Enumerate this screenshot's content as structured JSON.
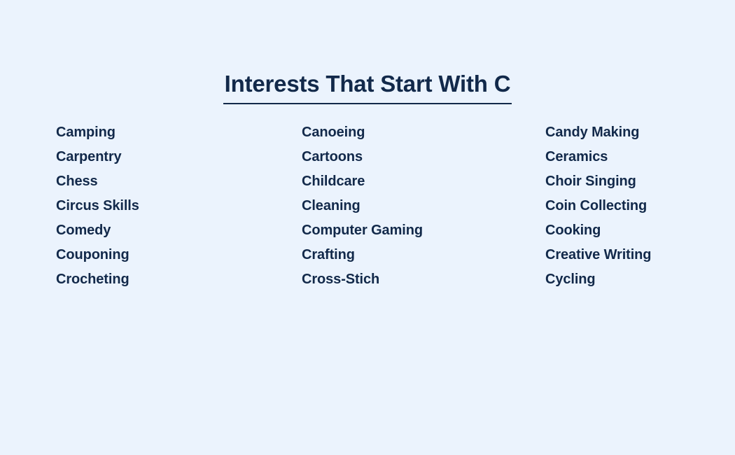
{
  "theme": {
    "background_color": "#ebf3fd",
    "text_color": "#12294a",
    "underline_color": "#12294a"
  },
  "header": {
    "title": "Interests That Start With C"
  },
  "list": {
    "columns": [
      {
        "items": [
          {
            "label": "Camping"
          },
          {
            "label": "Carpentry"
          },
          {
            "label": "Chess"
          },
          {
            "label": "Circus Skills"
          },
          {
            "label": "Comedy"
          },
          {
            "label": "Couponing"
          },
          {
            "label": "Crocheting"
          }
        ]
      },
      {
        "items": [
          {
            "label": "Canoeing"
          },
          {
            "label": "Cartoons"
          },
          {
            "label": "Childcare"
          },
          {
            "label": "Cleaning"
          },
          {
            "label": "Computer Gaming"
          },
          {
            "label": "Crafting"
          },
          {
            "label": "Cross-Stich"
          }
        ]
      },
      {
        "items": [
          {
            "label": "Candy Making"
          },
          {
            "label": "Ceramics"
          },
          {
            "label": "Choir Singing"
          },
          {
            "label": "Coin Collecting"
          },
          {
            "label": "Cooking"
          },
          {
            "label": "Creative Writing"
          },
          {
            "label": "Cycling"
          }
        ]
      }
    ]
  }
}
